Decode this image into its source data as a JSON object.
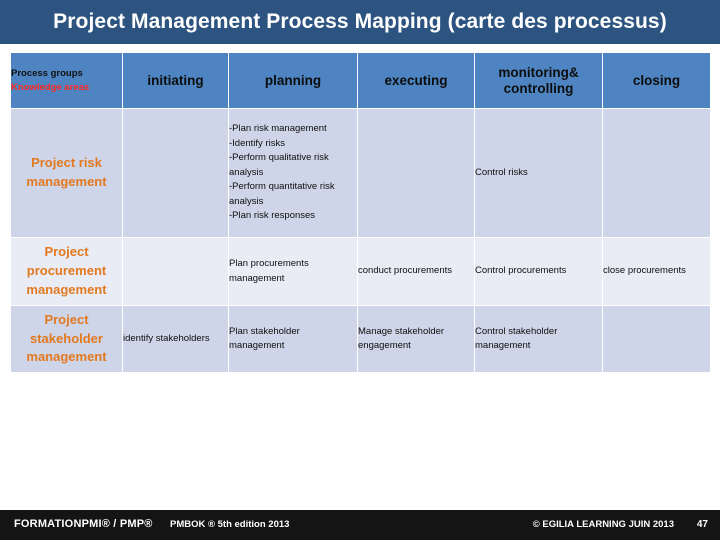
{
  "title": "Project Management Process Mapping  (carte des processus)",
  "colors": {
    "banner": "#2d5480",
    "table_header": "#4d84c1",
    "row_dark": "#ced5e8",
    "row_light": "#e9ecf5",
    "area_text": "#e3791f",
    "knowledge_label": "#ff2a20",
    "footer": "#141414"
  },
  "table": {
    "corner": {
      "process_groups_label": "Process groups",
      "knowledge_areas_label": "Knowledge areas"
    },
    "columns": [
      "initiating",
      "planning",
      "executing",
      "monitoring&\ncontrolling",
      "closing"
    ],
    "column_labels": {
      "initiating": "initiating",
      "planning": "planning",
      "executing": "executing",
      "monitoring_line1": "monitoring&",
      "monitoring_line2": "controlling",
      "closing": "closing"
    },
    "rows": [
      {
        "area": "Project risk\nmanagement",
        "area_line1": "Project risk",
        "area_line2": "management",
        "initiating": "",
        "planning": [
          "-Plan risk management",
          "-Identify risks",
          "-Perform qualitative risk analysis",
          "-Perform quantitative risk analysis",
          "-Plan risk responses"
        ],
        "executing": "",
        "monitoring": "Control risks",
        "closing": ""
      },
      {
        "area": "Project procurement management",
        "area_line1": "Project",
        "area_line2": "procurement",
        "area_line3": "management",
        "initiating": "",
        "planning": "Plan procurements management",
        "executing": "conduct procurements",
        "monitoring": "Control procurements",
        "closing": "close procurements"
      },
      {
        "area": "Project stakeholder management",
        "area_line1": "Project",
        "area_line2": "stakeholder",
        "area_line3": "management",
        "initiating": "identify stakeholders",
        "planning": "Plan stakeholder management",
        "executing": "Manage stakeholder engagement",
        "monitoring": "Control stakeholder management",
        "closing": ""
      }
    ]
  },
  "footer": {
    "left": "FORMATIONPMI® / PMP®",
    "middle": "PMBOK ® 5th edition  2013",
    "right": "© EGILIA LEARNING  JUIN 2013",
    "page_number": "47"
  }
}
